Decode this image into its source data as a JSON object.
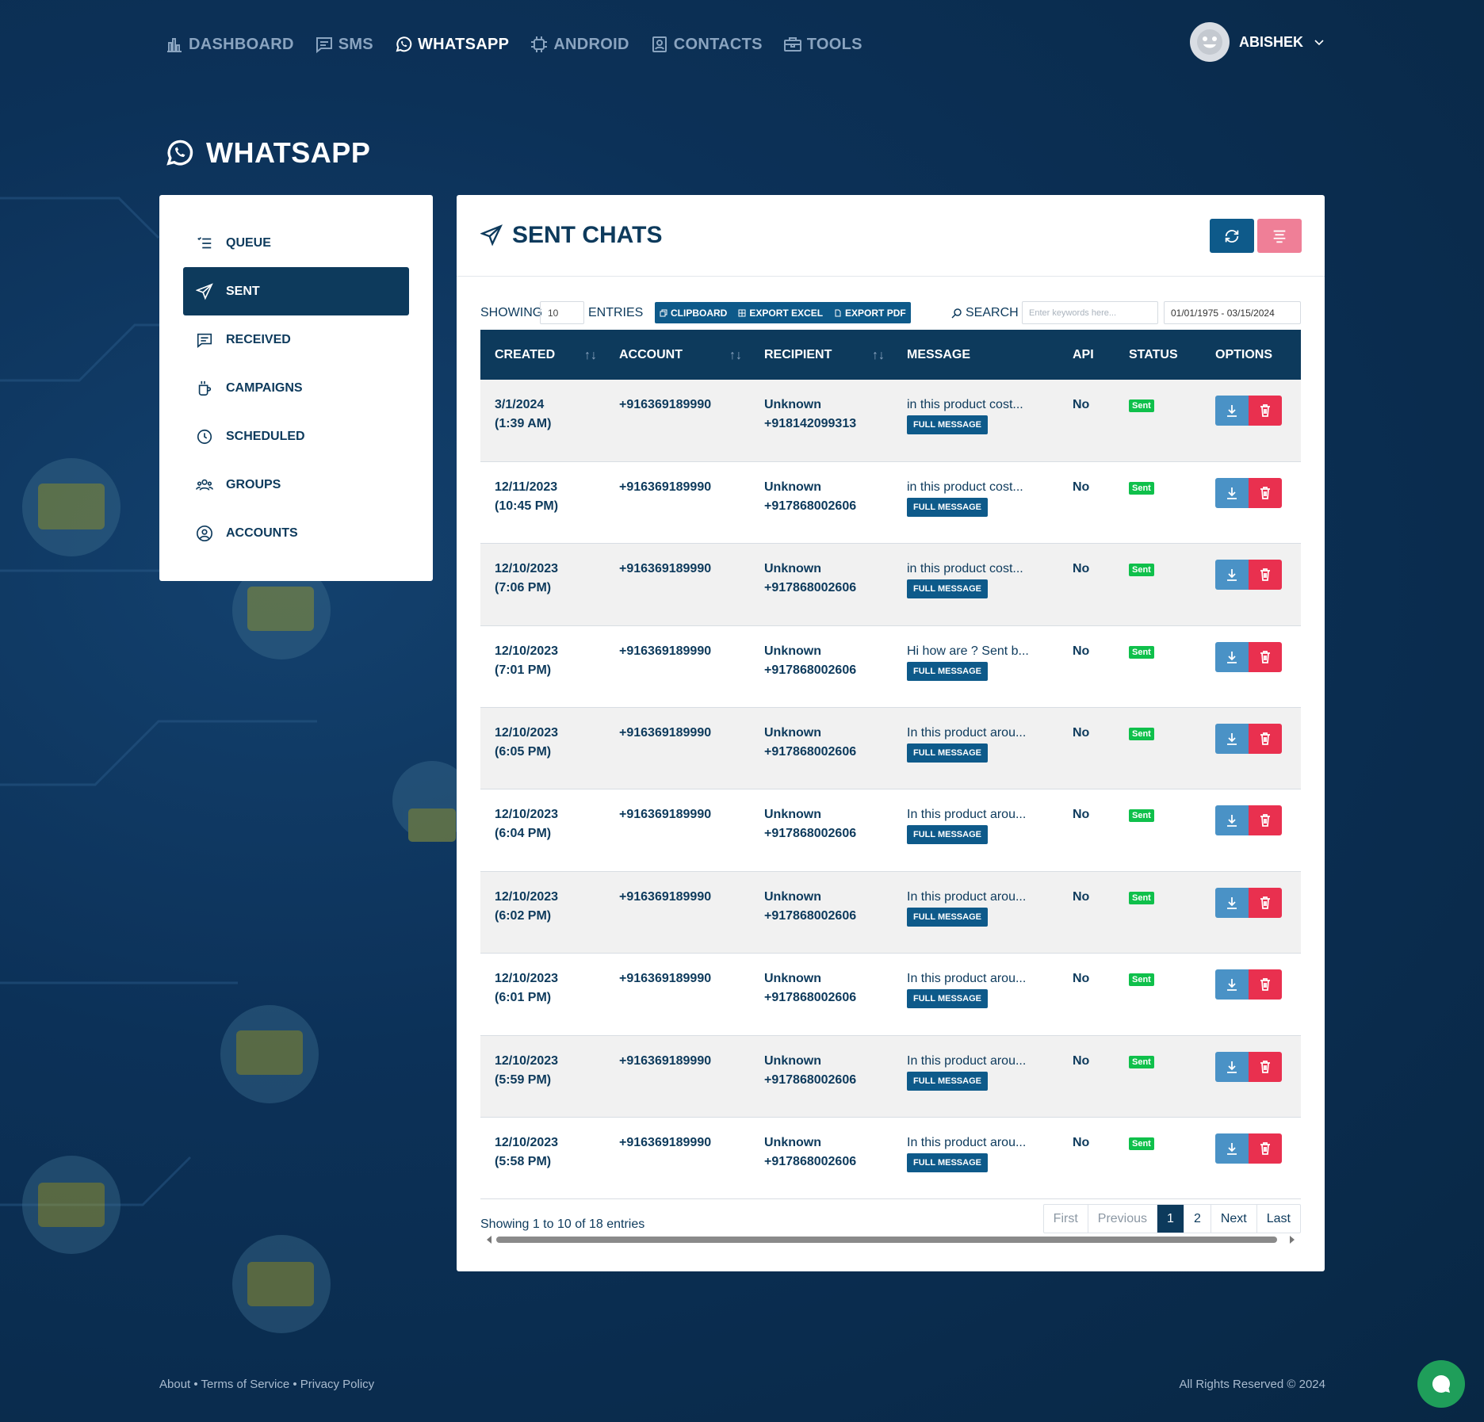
{
  "nav": {
    "items": [
      {
        "label": "DASHBOARD",
        "icon": "bar-chart-icon"
      },
      {
        "label": "SMS",
        "icon": "message-icon"
      },
      {
        "label": "WHATSAPP",
        "icon": "whatsapp-icon"
      },
      {
        "label": "ANDROID",
        "icon": "android-icon"
      },
      {
        "label": "CONTACTS",
        "icon": "contacts-icon"
      },
      {
        "label": "TOOLS",
        "icon": "toolbox-icon"
      }
    ],
    "active": "WHATSAPP"
  },
  "user": {
    "name": "ABISHEK"
  },
  "page": {
    "title": "WHATSAPP"
  },
  "sidebar": {
    "items": [
      {
        "label": "QUEUE",
        "icon": "queue-list-icon"
      },
      {
        "label": "SENT",
        "icon": "paper-plane-icon",
        "active": true
      },
      {
        "label": "RECEIVED",
        "icon": "chat-bubble-icon"
      },
      {
        "label": "CAMPAIGNS",
        "icon": "mug-icon"
      },
      {
        "label": "SCHEDULED",
        "icon": "clock-icon"
      },
      {
        "label": "GROUPS",
        "icon": "users-icon"
      },
      {
        "label": "ACCOUNTS",
        "icon": "user-circle-icon"
      }
    ]
  },
  "card": {
    "title": "SENT CHATS",
    "showing_label": "SHOWING",
    "entries_value": "10",
    "entries_label": "ENTRIES",
    "export": {
      "clipboard": "CLIPBOARD",
      "excel": "EXPORT EXCEL",
      "pdf": "EXPORT PDF"
    },
    "search_label": "SEARCH",
    "search_placeholder": "Enter keywords here...",
    "date_range": "01/01/1975 - 03/15/2024"
  },
  "table": {
    "columns": [
      "CREATED",
      "ACCOUNT",
      "RECIPIENT",
      "MESSAGE",
      "API",
      "STATUS",
      "OPTIONS"
    ],
    "full_message_label": "FULL MESSAGE",
    "rows": [
      {
        "date": "3/1/2024",
        "time": "(1:39 AM)",
        "account": "+916369189990",
        "recipient_name": "Unknown",
        "recipient_number": "+918142099313",
        "message": "in this product cost...",
        "api": "No",
        "status": "Sent"
      },
      {
        "date": "12/11/2023",
        "time": "(10:45 PM)",
        "account": "+916369189990",
        "recipient_name": "Unknown",
        "recipient_number": "+917868002606",
        "message": "in this product cost...",
        "api": "No",
        "status": "Sent"
      },
      {
        "date": "12/10/2023",
        "time": "(7:06 PM)",
        "account": "+916369189990",
        "recipient_name": "Unknown",
        "recipient_number": "+917868002606",
        "message": "in this product cost...",
        "api": "No",
        "status": "Sent"
      },
      {
        "date": "12/10/2023",
        "time": "(7:01 PM)",
        "account": "+916369189990",
        "recipient_name": "Unknown",
        "recipient_number": "+917868002606",
        "message": "Hi how are ? Sent b...",
        "api": "No",
        "status": "Sent"
      },
      {
        "date": "12/10/2023",
        "time": "(6:05 PM)",
        "account": "+916369189990",
        "recipient_name": "Unknown",
        "recipient_number": "+917868002606",
        "message": "In this product arou...",
        "api": "No",
        "status": "Sent"
      },
      {
        "date": "12/10/2023",
        "time": "(6:04 PM)",
        "account": "+916369189990",
        "recipient_name": "Unknown",
        "recipient_number": "+917868002606",
        "message": "In this product arou...",
        "api": "No",
        "status": "Sent"
      },
      {
        "date": "12/10/2023",
        "time": "(6:02 PM)",
        "account": "+916369189990",
        "recipient_name": "Unknown",
        "recipient_number": "+917868002606",
        "message": "In this product arou...",
        "api": "No",
        "status": "Sent"
      },
      {
        "date": "12/10/2023",
        "time": "(6:01 PM)",
        "account": "+916369189990",
        "recipient_name": "Unknown",
        "recipient_number": "+917868002606",
        "message": "In this product arou...",
        "api": "No",
        "status": "Sent"
      },
      {
        "date": "12/10/2023",
        "time": "(5:59 PM)",
        "account": "+916369189990",
        "recipient_name": "Unknown",
        "recipient_number": "+917868002606",
        "message": "In this product arou...",
        "api": "No",
        "status": "Sent"
      },
      {
        "date": "12/10/2023",
        "time": "(5:58 PM)",
        "account": "+916369189990",
        "recipient_name": "Unknown",
        "recipient_number": "+917868002606",
        "message": "In this product arou...",
        "api": "No",
        "status": "Sent"
      }
    ]
  },
  "info": "Showing 1 to 10 of 18 entries",
  "pagination": {
    "first": "First",
    "previous": "Previous",
    "pages": [
      "1",
      "2"
    ],
    "current": "1",
    "next": "Next",
    "last": "Last"
  },
  "footer": {
    "links": "About • Terms of Service • Privacy Policy",
    "copyright": "All Rights Reserved © 2024"
  },
  "colors": {
    "primary": "#0d3a5c",
    "accent": "#0e5a8a",
    "sent_badge": "#0fc04b",
    "delete": "#e9304f",
    "download": "#4a92c6"
  }
}
